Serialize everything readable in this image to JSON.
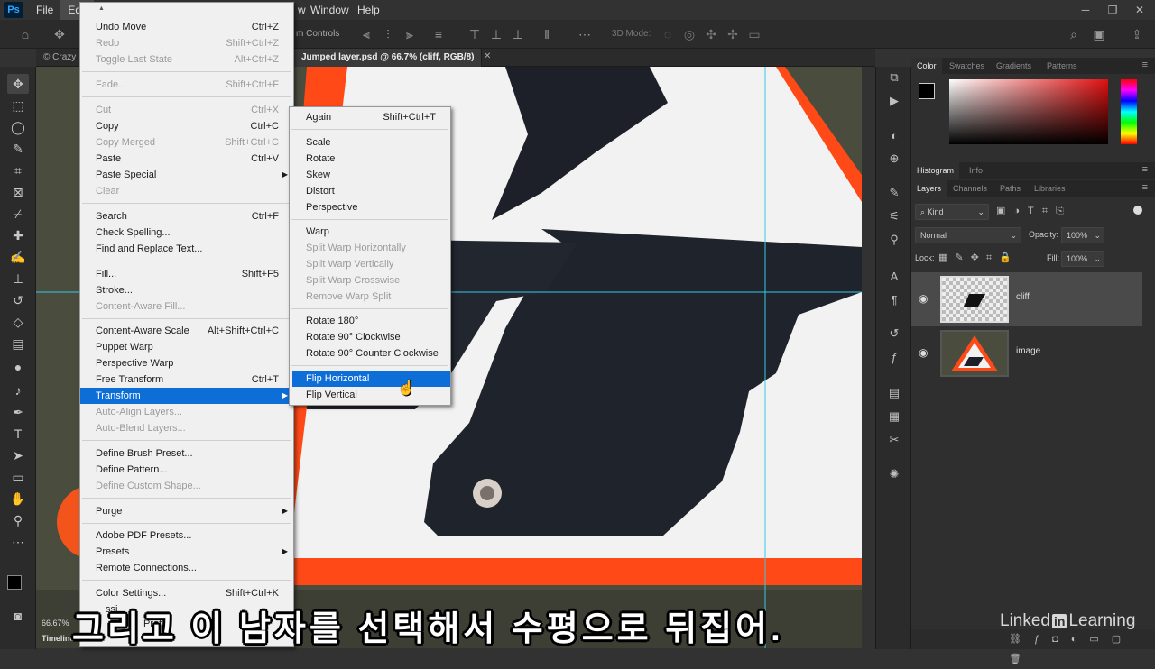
{
  "app": {
    "logo": "Ps"
  },
  "menubar": {
    "items": [
      "File",
      "Edit",
      "w",
      "Window",
      "Help"
    ]
  },
  "options_bar": {
    "text_controls": "m Controls",
    "text_3d": "3D Mode:"
  },
  "document": {
    "tab_left": "© Crazy",
    "tab_active": "Jumped layer.psd @ 66.7% (cliff, RGB/8)",
    "zoom": "66.67%",
    "timeline": "Timeline"
  },
  "edit_menu": {
    "undo": {
      "label": "Undo Move",
      "sc": "Ctrl+Z"
    },
    "redo": {
      "label": "Redo",
      "sc": "Shift+Ctrl+Z"
    },
    "toggle": {
      "label": "Toggle Last State",
      "sc": "Alt+Ctrl+Z"
    },
    "fade": {
      "label": "Fade...",
      "sc": "Shift+Ctrl+F"
    },
    "cut": {
      "label": "Cut",
      "sc": "Ctrl+X"
    },
    "copy": {
      "label": "Copy",
      "sc": "Ctrl+C"
    },
    "copy_merged": {
      "label": "Copy Merged",
      "sc": "Shift+Ctrl+C"
    },
    "paste": {
      "label": "Paste",
      "sc": "Ctrl+V"
    },
    "paste_special": {
      "label": "Paste Special"
    },
    "clear": {
      "label": "Clear"
    },
    "search": {
      "label": "Search",
      "sc": "Ctrl+F"
    },
    "check_spelling": {
      "label": "Check Spelling..."
    },
    "find_replace": {
      "label": "Find and Replace Text..."
    },
    "fill": {
      "label": "Fill...",
      "sc": "Shift+F5"
    },
    "stroke": {
      "label": "Stroke..."
    },
    "caf": {
      "label": "Content-Aware Fill..."
    },
    "cas": {
      "label": "Content-Aware Scale",
      "sc": "Alt+Shift+Ctrl+C"
    },
    "puppet": {
      "label": "Puppet Warp"
    },
    "persp_warp": {
      "label": "Perspective Warp"
    },
    "free_transform": {
      "label": "Free Transform",
      "sc": "Ctrl+T"
    },
    "transform": {
      "label": "Transform"
    },
    "auto_align": {
      "label": "Auto-Align Layers..."
    },
    "auto_blend": {
      "label": "Auto-Blend Layers..."
    },
    "brush_preset": {
      "label": "Define Brush Preset..."
    },
    "pattern": {
      "label": "Define Pattern..."
    },
    "custom_shape": {
      "label": "Define Custom Shape..."
    },
    "purge": {
      "label": "Purge"
    },
    "pdf_presets": {
      "label": "Adobe PDF Presets..."
    },
    "presets": {
      "label": "Presets"
    },
    "remote": {
      "label": "Remote Connections..."
    },
    "color_settings": {
      "label": "Color Settings...",
      "sc": "Shift+Ctrl+K"
    },
    "assign": {
      "label": "ssi"
    },
    "convert": {
      "label": "Prof"
    }
  },
  "transform_menu": {
    "again": {
      "label": "Again",
      "sc": "Shift+Ctrl+T"
    },
    "scale": "Scale",
    "rotate": "Rotate",
    "skew": "Skew",
    "distort": "Distort",
    "perspective": "Perspective",
    "warp": "Warp",
    "split_h": "Split Warp Horizontally",
    "split_v": "Split Warp Vertically",
    "split_c": "Split Warp Crosswise",
    "remove_split": "Remove Warp Split",
    "rot180": "Rotate 180°",
    "rot90cw": "Rotate 90° Clockwise",
    "rot90ccw": "Rotate 90° Counter Clockwise",
    "flip_h": "Flip Horizontal",
    "flip_v": "Flip Vertical"
  },
  "color_panel": {
    "tabs": [
      "Color",
      "Swatches",
      "Gradients",
      "Patterns"
    ],
    "fg": "#000000",
    "hue_color": "#e01010"
  },
  "mid_panel": {
    "tabs": [
      "Histogram",
      "Info"
    ]
  },
  "layers_panel": {
    "tabs": [
      "Layers",
      "Channels",
      "Paths",
      "Libraries"
    ],
    "kind": "Kind",
    "blend": "Normal",
    "opacity_label": "Opacity:",
    "opacity": "100%",
    "lock_label": "Lock:",
    "fill_label": "Fill:",
    "fill": "100%",
    "layers": [
      {
        "name": "cliff"
      },
      {
        "name": "image"
      }
    ]
  },
  "subtitle": "그리고 이 남자를 선택해서 수평으로 뒤집어.",
  "branding": {
    "pre": "Linked",
    "in": "in",
    "post": "Learning"
  }
}
